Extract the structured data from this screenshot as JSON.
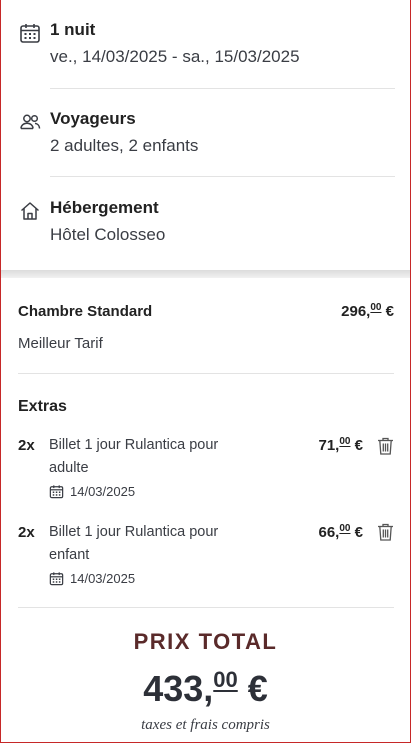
{
  "stay": {
    "nights_label": "1 nuit",
    "dates": "ve., 14/03/2025 - sa., 15/03/2025"
  },
  "travelers": {
    "title": "Voyageurs",
    "value": "2 adultes, 2 enfants"
  },
  "accommodation": {
    "title": "Hébergement",
    "value": "Hôtel Colosseo"
  },
  "room": {
    "name": "Chambre Standard",
    "price_int": "296,",
    "price_cents": "00",
    "currency": "€",
    "rate": "Meilleur Tarif"
  },
  "extras": {
    "title": "Extras",
    "items": [
      {
        "qty": "2x",
        "name": "Billet 1 jour Rulantica pour adulte",
        "date": "14/03/2025",
        "price_int": "71,",
        "price_cents": "00",
        "currency": "€"
      },
      {
        "qty": "2x",
        "name": "Billet 1 jour Rulantica pour enfant",
        "date": "14/03/2025",
        "price_int": "66,",
        "price_cents": "00",
        "currency": "€"
      }
    ]
  },
  "total": {
    "label": "PRIX TOTAL",
    "value_int": "433,",
    "value_cents": "00",
    "currency": "€",
    "note": "taxes et frais compris"
  },
  "icons": [
    "calendar-icon",
    "users-icon",
    "home-icon",
    "trash-icon"
  ],
  "colors": {
    "accent_dark_red": "#5a2a2a",
    "frame_border": "#c62828"
  }
}
